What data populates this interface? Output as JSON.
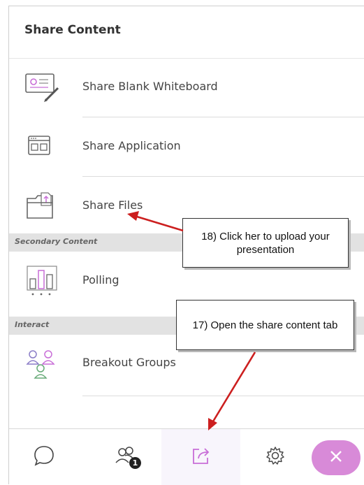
{
  "panel": {
    "title": "Share Content"
  },
  "items": [
    {
      "label": "Share Blank Whiteboard",
      "icon": "whiteboard-icon"
    },
    {
      "label": "Share Application",
      "icon": "application-window-icon"
    },
    {
      "label": "Share Files",
      "icon": "file-folder-icon"
    },
    {
      "label": "Polling",
      "icon": "poll-chart-icon"
    },
    {
      "label": "Breakout Groups",
      "icon": "breakout-groups-icon"
    }
  ],
  "sections": {
    "secondary": "Secondary Content",
    "interact": "Interact"
  },
  "callouts": {
    "upload": "18) Click her to upload your presentation",
    "open_tab": "17) Open the share content tab"
  },
  "bottom_bar": {
    "chat_icon": "chat-icon",
    "attendees_icon": "attendees-icon",
    "attendees_badge": "1",
    "share_icon": "share-content-icon",
    "settings_icon": "gear-icon",
    "close_icon": "close-icon"
  },
  "colors": {
    "accent": "#c86dd7",
    "close_button": "#d88ad8",
    "arrow": "#cc1f1f",
    "section_bg": "#e2e2e2"
  }
}
